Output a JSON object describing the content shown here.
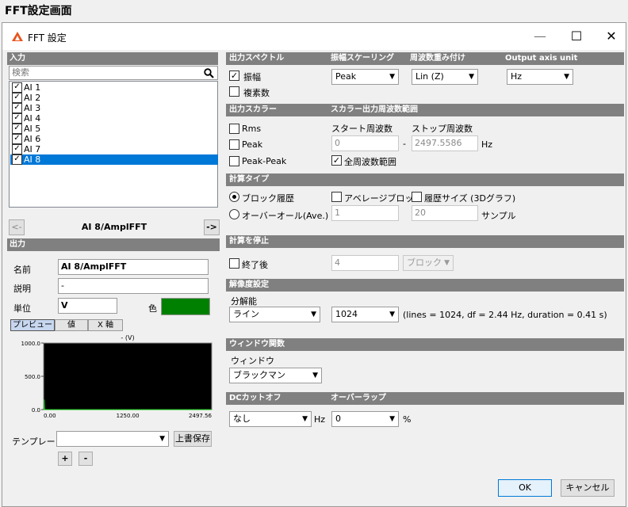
{
  "page_title": "FFT設定画面",
  "window": {
    "title": "FFT 設定",
    "minimize": "—",
    "maximize": "☐",
    "close": "✕"
  },
  "left": {
    "input_header": "入力",
    "search_placeholder": "検索",
    "channels": [
      {
        "label": "AI 1",
        "checked": true,
        "selected": false
      },
      {
        "label": "AI 2",
        "checked": true,
        "selected": false
      },
      {
        "label": "AI 3",
        "checked": true,
        "selected": false
      },
      {
        "label": "AI 4",
        "checked": true,
        "selected": false
      },
      {
        "label": "AI 5",
        "checked": true,
        "selected": false
      },
      {
        "label": "AI 6",
        "checked": true,
        "selected": false
      },
      {
        "label": "AI 7",
        "checked": true,
        "selected": false
      },
      {
        "label": "AI 8",
        "checked": true,
        "selected": true
      }
    ],
    "prev_btn": "<-",
    "next_btn": "->",
    "current_channel": "AI 8/AmplFFT",
    "output_header": "出力",
    "name_label": "名前",
    "name_value": "AI 8/AmplFFT",
    "desc_label": "説明",
    "desc_value": "-",
    "unit_label": "単位",
    "unit_value": "V",
    "color_label": "色",
    "color_value": "#008000",
    "tabs": [
      "プレビュー",
      "値",
      "X 軸"
    ],
    "preview_title": "- (V)",
    "template_label": "テンプレート",
    "overwrite_btn": "上書保存",
    "add_btn": "+",
    "remove_btn": "-"
  },
  "chart_data": {
    "type": "line",
    "title": "- (V)",
    "xlabel": "",
    "ylabel": "",
    "x_ticks": [
      "0.00",
      "1250.00",
      "2497.56"
    ],
    "y_ticks": [
      "1000.0",
      "500.0",
      "0.0"
    ],
    "xlim": [
      0,
      2497.56
    ],
    "ylim": [
      0,
      1000
    ],
    "series": [
      {
        "x": [
          0,
          5,
          9.8,
          15,
          25,
          50,
          100,
          500,
          1000,
          1500,
          2000,
          2497.56
        ],
        "y": [
          0,
          2,
          150,
          5,
          2,
          0,
          0,
          0,
          0,
          0,
          0,
          0
        ]
      }
    ],
    "colors": {
      "background": "#000000",
      "line": "#00c000"
    }
  },
  "right": {
    "spectrum_header": "出力スペクトル",
    "amp_scaling_header": "振幅スケーリング",
    "freq_weight_header": "周波数重み付け",
    "axis_unit_header": "Output axis unit",
    "amplitude_label": "振幅",
    "amplitude_checked": true,
    "complex_label": "複素数",
    "complex_checked": false,
    "amp_scaling_value": "Peak",
    "freq_weight_value": "Lin (Z)",
    "axis_unit_value": "Hz",
    "color_header": "出力スカラー",
    "scalar_range_header": "スカラー出力周波数範囲",
    "rms_label": "Rms",
    "peak_label": "Peak",
    "peakpeak_label": "Peak-Peak",
    "start_freq_label": "スタート周波数",
    "stop_freq_label": "ストップ周波数",
    "start_freq_value": "0",
    "stop_freq_value": "2497.5586",
    "range_dash": "-",
    "hz_unit": "Hz",
    "all_range_label": "全周波数範囲",
    "calc_type_header": "計算タイプ",
    "block_history_label": "ブロック履歴",
    "overall_label": "オーバーオール(Ave.)",
    "average_block_label": "アベレージブロック",
    "history_size_label": "履歴サイズ (3Dグラフ)",
    "average_value": "1",
    "history_value": "20",
    "samples_unit": "サンプル",
    "stop_calc_header": "計算を停止",
    "after_end_label": "終了後",
    "after_end_value": "4",
    "after_end_unit": "ブロック",
    "resolution_header": "解像度設定",
    "resolution_label": "分解能",
    "resolution_mode": "ライン",
    "resolution_value": "1024",
    "resolution_info": "(lines = 1024, df = 2.44 Hz, duration = 0.41 s)",
    "window_func_header": "ウィンドウ関数",
    "window_label": "ウィンドウ",
    "window_value": "ブラックマン",
    "dc_cutoff_header": "DCカットオフ",
    "overlap_header": "オーバーラップ",
    "dc_value": "なし",
    "dc_unit": "Hz",
    "overlap_value": "0",
    "overlap_unit": "%"
  },
  "footer": {
    "ok": "OK",
    "cancel": "キャンセル"
  }
}
